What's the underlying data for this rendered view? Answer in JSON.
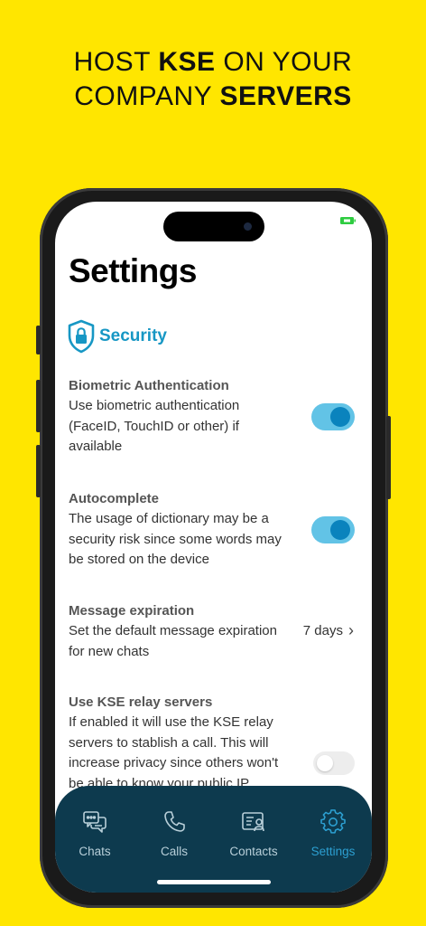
{
  "headline": {
    "line1_pre": "HOST ",
    "line1_bold": "KSE",
    "line1_post": " ON YOUR",
    "line2_pre": "COMPANY ",
    "line2_bold": "SERVERS"
  },
  "page_title": "Settings",
  "section": {
    "label": "Security",
    "icon": "shield-lock-icon"
  },
  "settings": [
    {
      "title": "Biometric Authentication",
      "description": "Use biometric authentication (FaceID, TouchID or other) if available",
      "control": "toggle",
      "enabled": true
    },
    {
      "title": "Autocomplete",
      "description": "The usage of dictionary may be a security risk since some words may be stored on the device",
      "control": "toggle",
      "enabled": true
    },
    {
      "title": "Message expiration",
      "description": "Set the default message expiration for new chats",
      "control": "value",
      "value": "7 days"
    },
    {
      "title": "Use KSE relay servers",
      "description": "If enabled it will use the KSE relay servers to stablish a call. This will increase privacy since others won't be able to know your public IP",
      "control": "toggle",
      "enabled": false
    }
  ],
  "tabs": [
    {
      "label": "Chats",
      "icon": "chat-bubbles-icon",
      "active": false
    },
    {
      "label": "Calls",
      "icon": "phone-icon",
      "active": false
    },
    {
      "label": "Contacts",
      "icon": "contact-card-icon",
      "active": false
    },
    {
      "label": "Settings",
      "icon": "gear-icon",
      "active": true
    }
  ],
  "colors": {
    "background": "#ffe600",
    "accent": "#1797c4",
    "toggle_on_track": "#62c3e6",
    "toggle_on_knob": "#0a83bd",
    "tabbar": "#0d3a4e",
    "battery": "#2ecc40"
  }
}
